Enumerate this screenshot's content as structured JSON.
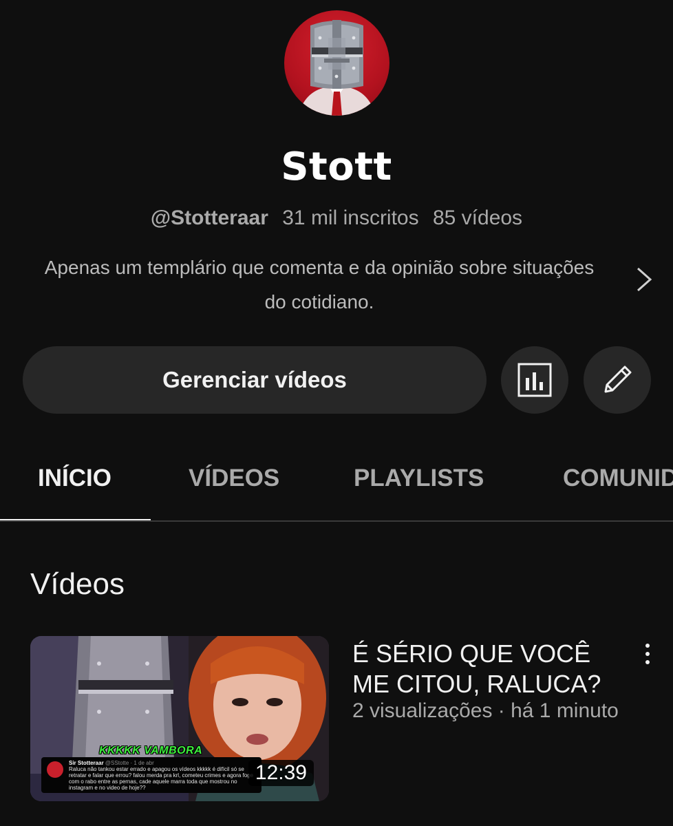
{
  "channel": {
    "name": "Stott",
    "handle": "@Stotteraar",
    "subscribers": "31 mil inscritos",
    "video_count": "85 vídeos",
    "description": "Apenas um templário que comenta e da opinião sobre situações do cotidiano."
  },
  "actions": {
    "manage_label": "Gerenciar vídeos",
    "analytics_icon": "analytics-icon",
    "edit_icon": "pencil-icon"
  },
  "tabs": [
    {
      "label": "INÍCIO",
      "active": true
    },
    {
      "label": "VÍDEOS",
      "active": false
    },
    {
      "label": "PLAYLISTS",
      "active": false
    },
    {
      "label": "COMUNIDADE",
      "active": false
    }
  ],
  "section": {
    "title": "Vídeos"
  },
  "video": {
    "title": "É SÉRIO QUE VOCÊ ME CITOU, RALUCA?",
    "meta": "2 visualizações · há 1 minuto",
    "duration": "12:39",
    "thumbnail": {
      "caption": "KKKKK VAMBORA",
      "tweet_author": "Sir Stotteraar",
      "tweet_handle": "@SStotte · 1 de abr",
      "tweet_text": "Raluca não tankou estar errado e apagou os vídeos kkkkk é difícil só se retratar e falar que errou? falou merda pra krl, cometeu crimes e agora foge com o rabo entre as pernas, cade aquele marra toda que mostrou no instagram e no video de hoje??"
    }
  },
  "colors": {
    "background": "#0f0f0f",
    "surface": "#272727",
    "text_primary": "#f1f1f1",
    "text_secondary": "#aaaaaa",
    "avatar_red": "#c9202c"
  }
}
